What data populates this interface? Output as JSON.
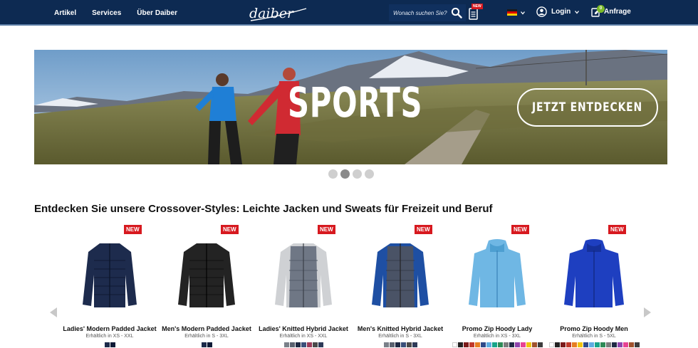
{
  "header": {
    "nav": [
      "Artikel",
      "Services",
      "Über Daiber"
    ],
    "logo_text": "daiber",
    "search_placeholder": "Wonach suchen Sie?",
    "new_label": "NEW",
    "login_label": "Login",
    "anfrage_label": "Anfrage",
    "anfrage_count": "0",
    "bg_color": "#0d2a52"
  },
  "banner": {
    "title": "SPORTS",
    "cta": "JETZT ENTDECKEN",
    "active_slide": 2,
    "slides": 4
  },
  "section_title": "Entdecken Sie unsere Crossover-Styles: Leichte Jacken und Sweats für Freizeit und Beruf",
  "new_tag": "NEW",
  "products": [
    {
      "name": "Ladies' Modern Padded Jacket",
      "sizes": "Erhältlich in XS - XXL",
      "colors": [
        "#1c2a4a",
        "#0e1a36"
      ]
    },
    {
      "name": "Men's Modern Padded Jacket",
      "sizes": "Erhältlich in S - 3XL",
      "colors": [
        "#1c2a4a",
        "#0e1a36"
      ]
    },
    {
      "name": "Ladies' Knitted Hybrid Jacket",
      "sizes": "Erhältlich in XS - XXL",
      "colors": [
        "#7a8089",
        "#5b6270",
        "#1f2a44",
        "#3a4f7a",
        "#9a3b5a",
        "#4a4a4a",
        "#2d3a58"
      ]
    },
    {
      "name": "Men's Knitted Hybrid Jacket",
      "sizes": "Erhältlich in S - 3XL",
      "colors": [
        "#7a8089",
        "#5b6270",
        "#1f2a44",
        "#3a4f7a",
        "#4a4a4a",
        "#2d3a58"
      ]
    },
    {
      "name": "Promo Zip Hoody Lady",
      "sizes": "Erhältlich in XS - 3XL",
      "colors": [
        "#ffffff",
        "#222222",
        "#7b1b1b",
        "#c0392b",
        "#e67e22",
        "#2e4a8a",
        "#5dade2",
        "#17a589",
        "#2e8b57",
        "#7b7d7d",
        "#1f2a44",
        "#8e44ad",
        "#e84393",
        "#f1c40f",
        "#a0522d",
        "#3d3d3d"
      ]
    },
    {
      "name": "Promo Zip Hoody Men",
      "sizes": "Erhältlich in S - 5XL",
      "colors": [
        "#ffffff",
        "#222222",
        "#7b1b1b",
        "#c0392b",
        "#e67e22",
        "#f1c40f",
        "#2e4a8a",
        "#5dade2",
        "#17a589",
        "#2e8b57",
        "#7b7d7d",
        "#1f2a44",
        "#8e44ad",
        "#e84393",
        "#a0522d",
        "#3d3d3d"
      ]
    }
  ]
}
